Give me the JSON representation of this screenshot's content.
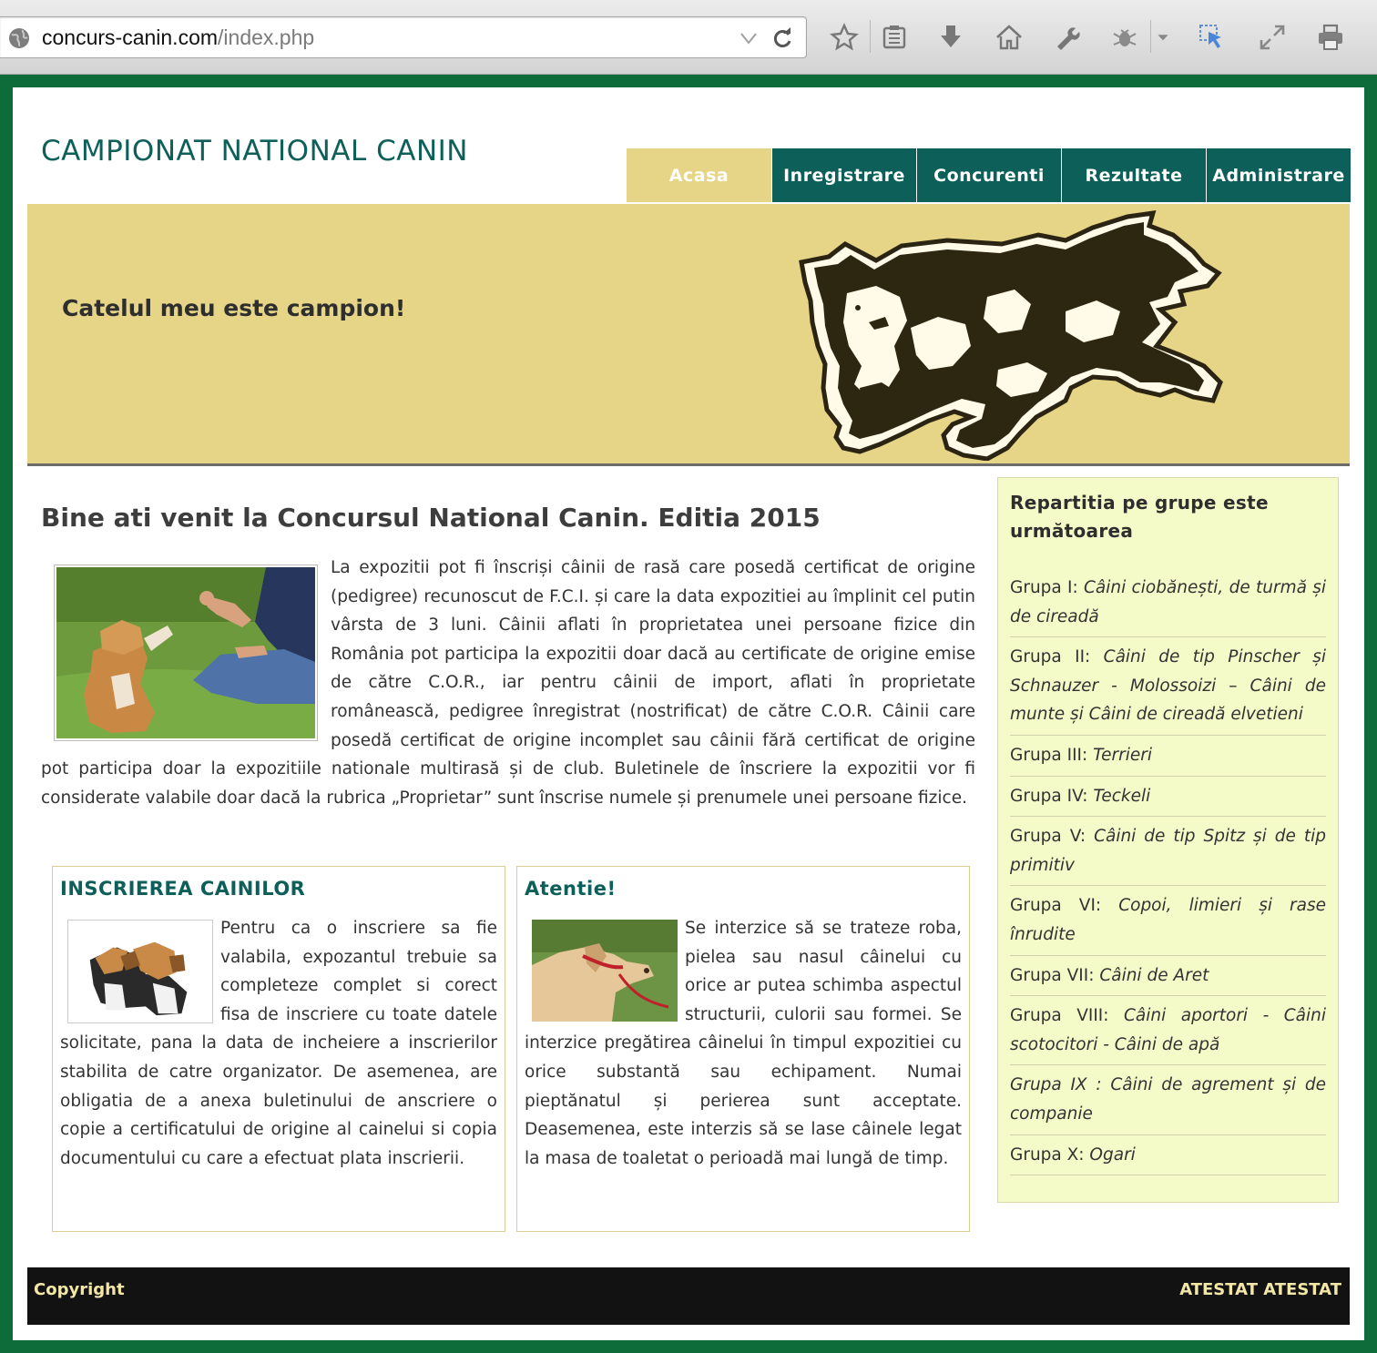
{
  "browser": {
    "url_host": "concurs-canin.com",
    "url_path": "/index.php"
  },
  "site": {
    "title": "CAMPIONAT NATIONAL CANIN",
    "nav": [
      {
        "label": "Acasa",
        "active": true
      },
      {
        "label": "Inregistrare",
        "active": false
      },
      {
        "label": "Concurenti",
        "active": false
      },
      {
        "label": "Rezultate",
        "active": false
      },
      {
        "label": "Administrare",
        "active": false
      }
    ],
    "banner_slogan": "Catelul meu este campion!"
  },
  "main": {
    "welcome": "Bine ati venit la Concursul National Canin. Editia 2015",
    "intro": "La expozitii pot fi înscriși câinii de rasă care posedă certificat de origine (pedigree) recunoscut de F.C.I. și care la data expozitiei au împlinit cel putin vârsta de 3 luni. Câinii aflati în proprietatea unei persoane fizice din România pot participa la expozitii doar dacă au certificate de origine emise de către C.O.R., iar pentru câinii de import, aflati în proprietate românească, pedigree înregistrat (nostrificat) de către C.O.R. Câinii care posedă certificat de origine incomplet sau câinii fără certificat de origine pot participa doar la expozitiile nationale multirasă și de club. Buletinele de înscriere la expozitii vor fi considerate valabile doar dacă la rubrica „Proprietar” sunt înscrise numele și prenumele unei persoane fizice.",
    "box_left": {
      "title": "INSCRIEREA CAINILOR",
      "text": "Pentru ca o inscriere sa fie valabila, expozantul trebuie sa completeze complet si corect fisa de inscriere cu toate datele solicitate, pana la data de incheiere a inscrierilor stabilita de catre organizator. De asemenea, are obligatia de a anexa buletinului de anscriere o copie a certificatului de origine al cainelui si copia documentului cu care a efectuat plata inscrierii."
    },
    "box_right": {
      "title": "Atentie!",
      "text": "Se interzice să se trateze roba, pielea sau nasul câinelui cu orice ar putea schimba aspectul structurii, culorii sau formei. Se interzice pregătirea câinelui în timpul expozitiei cu orice substantă sau echipament. Numai pieptănatul și perierea sunt acceptate. Deasemenea, este interzis să se lase câinele legat la masa de toaletat o perioadă mai lungă de timp."
    }
  },
  "sidebar": {
    "title": "Repartitia pe grupe este următoarea",
    "groups": [
      {
        "label": "Grupa I: ",
        "name": "Câini ciobănești, de turmă și de cireadă"
      },
      {
        "label": "Grupa II: ",
        "name": "Câini de tip Pinscher și Schnauzer - Molossoizi – Câini de munte și Câini de cireadă elvetieni"
      },
      {
        "label": "Grupa III: ",
        "name": "Terrieri"
      },
      {
        "label": "Grupa IV: ",
        "name": "Teckeli"
      },
      {
        "label": "Grupa V: ",
        "name": "Câini de tip Spitz și de tip primitiv"
      },
      {
        "label": "Grupa VI: ",
        "name": "Copoi, limieri și rase înrudite"
      },
      {
        "label": "Grupa VII: ",
        "name": "Câini de Aret"
      },
      {
        "label": "Grupa VIII: ",
        "name": "Câini aportori - Câini scotocitori - Câini de apă"
      },
      {
        "label": "Grupa IX : ",
        "name": "Câini de agrement și de companie"
      },
      {
        "label": "Grupa X: ",
        "name": "Ogari"
      }
    ]
  },
  "footer": {
    "left": "Copyright",
    "right": "ATESTAT ATESTAT"
  },
  "colors": {
    "frame": "#0e6b3a",
    "teal": "#0d5f5a",
    "banner": "#e6d587",
    "sidebar": "#f4fbc8",
    "footer": "#121212",
    "footer_text": "#f3e7a7"
  }
}
